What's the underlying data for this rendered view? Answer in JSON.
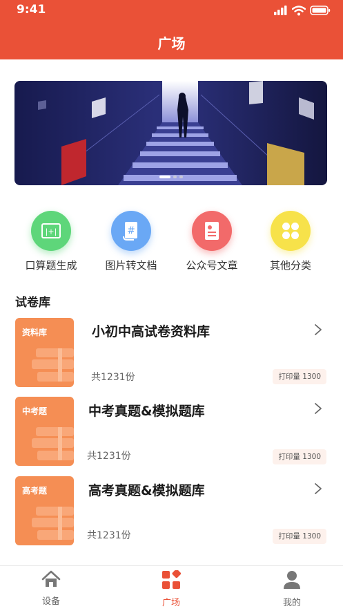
{
  "status_bar": {
    "time": "9:41"
  },
  "header": {
    "title": "广场"
  },
  "banner": {
    "slides": 3,
    "active_slide": 1
  },
  "actions": [
    {
      "label": "口算题生成",
      "icon": "calculator-icon",
      "color": "#5ed67a"
    },
    {
      "label": "图片转文档",
      "icon": "document-icon",
      "color": "#6aa8f5"
    },
    {
      "label": "公众号文章",
      "icon": "article-icon",
      "color": "#f26a6a"
    },
    {
      "label": "其他分类",
      "icon": "grid-icon",
      "color": "#f7e24a"
    }
  ],
  "section": {
    "title": "试卷库"
  },
  "papers": [
    {
      "cover_label": "资料库",
      "title": "小初中高试卷资料库",
      "count": "共1231份",
      "print": "打印量 1300"
    },
    {
      "cover_label": "中考题",
      "title": "中考真题&模拟题库",
      "count": "共1231份",
      "print": "打印量 1300"
    },
    {
      "cover_label": "高考题",
      "title": "高考真题&模拟题库",
      "count": "共1231份",
      "print": "打印量 1300"
    }
  ],
  "tabbar": {
    "items": [
      {
        "label": "设备",
        "icon": "home-icon",
        "active": false
      },
      {
        "label": "广场",
        "icon": "square-grid-icon",
        "active": true
      },
      {
        "label": "我的",
        "icon": "user-icon",
        "active": false
      }
    ]
  },
  "colors": {
    "accent": "#ea5137",
    "cover": "#f58e54"
  }
}
